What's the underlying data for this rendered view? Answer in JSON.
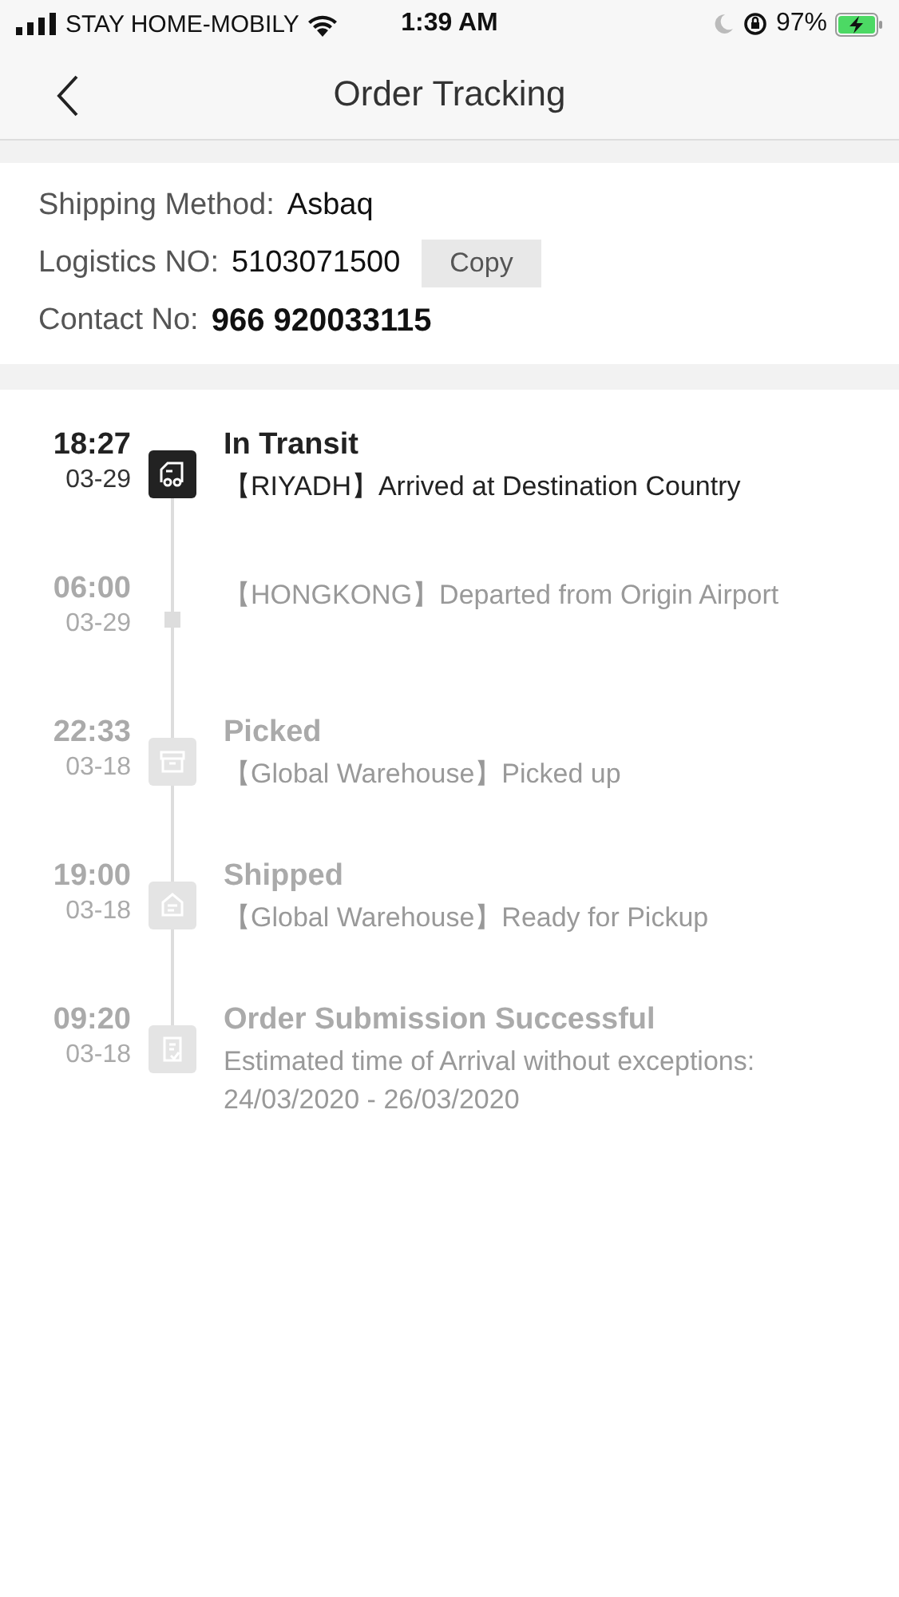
{
  "status_bar": {
    "carrier": "STAY HOME-MOBILY",
    "time": "1:39 AM",
    "battery": "97%"
  },
  "nav": {
    "title": "Order Tracking"
  },
  "shipping": {
    "method_label": "Shipping Method:",
    "method": "Asbaq",
    "logistics_label": "Logistics NO:",
    "logistics_no": "5103071500",
    "copy_button": "Copy",
    "contact_label": "Contact No:",
    "contact_no": "966 920033115"
  },
  "events": [
    {
      "time": "18:27",
      "date": "03-29",
      "title": "In Transit",
      "description": "【RIYADH】Arrived at Destination Country",
      "kind": "truck",
      "active": true
    },
    {
      "time": "06:00",
      "date": "03-29",
      "description": "【HONGKONG】Departed from Origin Airport",
      "kind": "dot",
      "active": false
    },
    {
      "time": "22:33",
      "date": "03-18",
      "title": "Picked",
      "description": "【Global Warehouse】Picked up",
      "kind": "box",
      "active": false
    },
    {
      "time": "19:00",
      "date": "03-18",
      "title": "Shipped",
      "description": "【Global Warehouse】Ready for Pickup",
      "kind": "house",
      "active": false
    },
    {
      "time": "09:20",
      "date": "03-18",
      "title": "Order Submission Successful",
      "description": "Estimated time of Arrival without exceptions: 24/03/2020 - 26/03/2020",
      "kind": "document",
      "active": false
    }
  ]
}
